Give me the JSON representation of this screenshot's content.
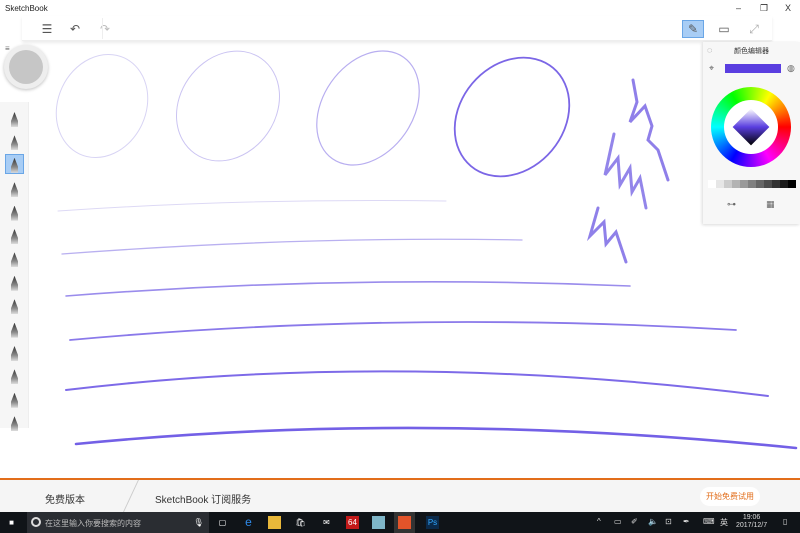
{
  "app": {
    "title": "SketchBook",
    "minimize": "–",
    "restore": "❐",
    "close": "X"
  },
  "toolbar": {
    "list_icon": "☰",
    "undo_icon": "↶",
    "redo_icon": "↷",
    "pen_icon": "✎",
    "window_icon": "▭",
    "fullscreen_icon": "⤢"
  },
  "brushes": {
    "selected_index": 2,
    "count": 14
  },
  "color_panel": {
    "title": "颜色编辑器",
    "color": "#5a3ee0",
    "eyedropper_icon": "⌖",
    "settings_icon": "⊶",
    "grid_icon": "▦"
  },
  "footer": {
    "free_version": "免费版本",
    "subscription": "SketchBook 订阅服务",
    "trial_button": "开始免费试用"
  },
  "taskbar": {
    "search_placeholder": "在这里输入你要搜索的内容",
    "ime": "英",
    "time": "19:06",
    "date": "2017/12/7",
    "app_64": "64",
    "app_ps": "Ps"
  }
}
